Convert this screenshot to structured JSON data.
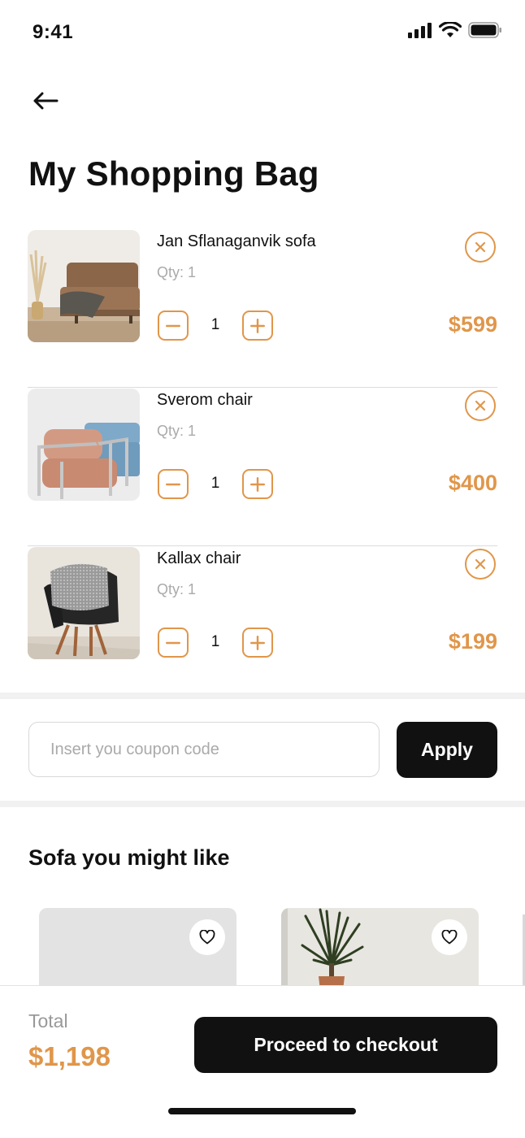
{
  "status_bar": {
    "time": "9:41"
  },
  "header": {
    "title": "My Shopping Bag"
  },
  "cart": {
    "items": [
      {
        "name": "Jan Sflanaganvik sofa",
        "qty_label": "Qty: 1",
        "quantity": "1",
        "price": "$599",
        "image": "brown-sofa"
      },
      {
        "name": "Sverom chair",
        "qty_label": "Qty: 1",
        "quantity": "1",
        "price": "$400",
        "image": "pink-armchair"
      },
      {
        "name": "Kallax chair",
        "qty_label": "Qty: 1",
        "quantity": "1",
        "price": "$199",
        "image": "black-chair"
      }
    ]
  },
  "coupon": {
    "placeholder": "Insert you coupon code",
    "value": "",
    "apply_label": "Apply"
  },
  "suggestions": {
    "title": "Sofa you might like"
  },
  "footer": {
    "total_label": "Total",
    "total_value": "$1,198",
    "checkout_label": "Proceed to checkout"
  },
  "colors": {
    "accent": "#e0964a",
    "primary": "#111111",
    "muted": "#aaaaaa"
  }
}
